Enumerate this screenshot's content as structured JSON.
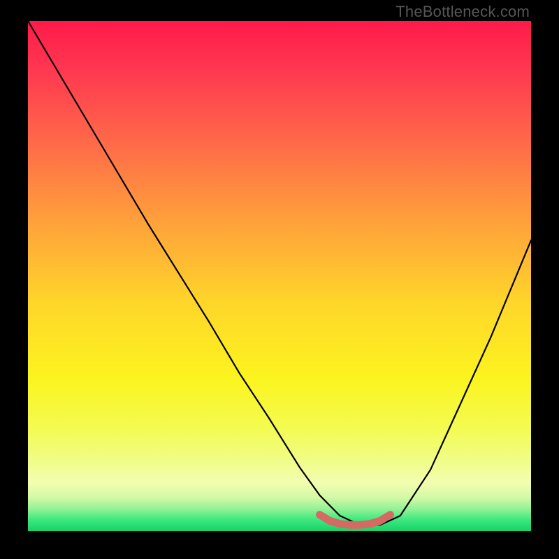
{
  "watermark": "TheBottleneck.com",
  "chart_data": {
    "type": "line",
    "title": "",
    "xlabel": "",
    "ylabel": "",
    "xlim": [
      0,
      100
    ],
    "ylim": [
      0,
      100
    ],
    "grid": false,
    "legend": false,
    "series": [
      {
        "name": "bottleneck-curve",
        "color": "#000000",
        "x": [
          0,
          6,
          12,
          18,
          24,
          30,
          36,
          42,
          48,
          54,
          58,
          62,
          66,
          70,
          74,
          80,
          86,
          92,
          100
        ],
        "values": [
          100,
          90,
          80,
          70,
          60,
          50.5,
          41,
          31,
          22,
          12.5,
          7,
          3,
          1.2,
          1.2,
          3,
          12,
          25,
          38,
          57
        ]
      },
      {
        "name": "highlight-segment",
        "color": "#d46a63",
        "stroke_width": 11,
        "x": [
          58,
          60,
          62,
          64,
          66,
          68,
          70,
          72
        ],
        "values": [
          3.2,
          2.0,
          1.4,
          1.2,
          1.2,
          1.4,
          2.0,
          3.2
        ]
      }
    ],
    "background_gradient": {
      "stops": [
        {
          "offset": 0.0,
          "color": "#ff1a4a"
        },
        {
          "offset": 0.1,
          "color": "#ff3950"
        },
        {
          "offset": 0.25,
          "color": "#ff6e48"
        },
        {
          "offset": 0.4,
          "color": "#ffa33a"
        },
        {
          "offset": 0.55,
          "color": "#ffd52a"
        },
        {
          "offset": 0.7,
          "color": "#fbf41e"
        },
        {
          "offset": 0.8,
          "color": "#f4fb52"
        },
        {
          "offset": 0.86,
          "color": "#f0fd86"
        },
        {
          "offset": 0.905,
          "color": "#f3feb0"
        },
        {
          "offset": 0.935,
          "color": "#d2f9a6"
        },
        {
          "offset": 0.958,
          "color": "#8ff195"
        },
        {
          "offset": 0.978,
          "color": "#3ce87f"
        },
        {
          "offset": 1.0,
          "color": "#17d268"
        }
      ]
    }
  }
}
